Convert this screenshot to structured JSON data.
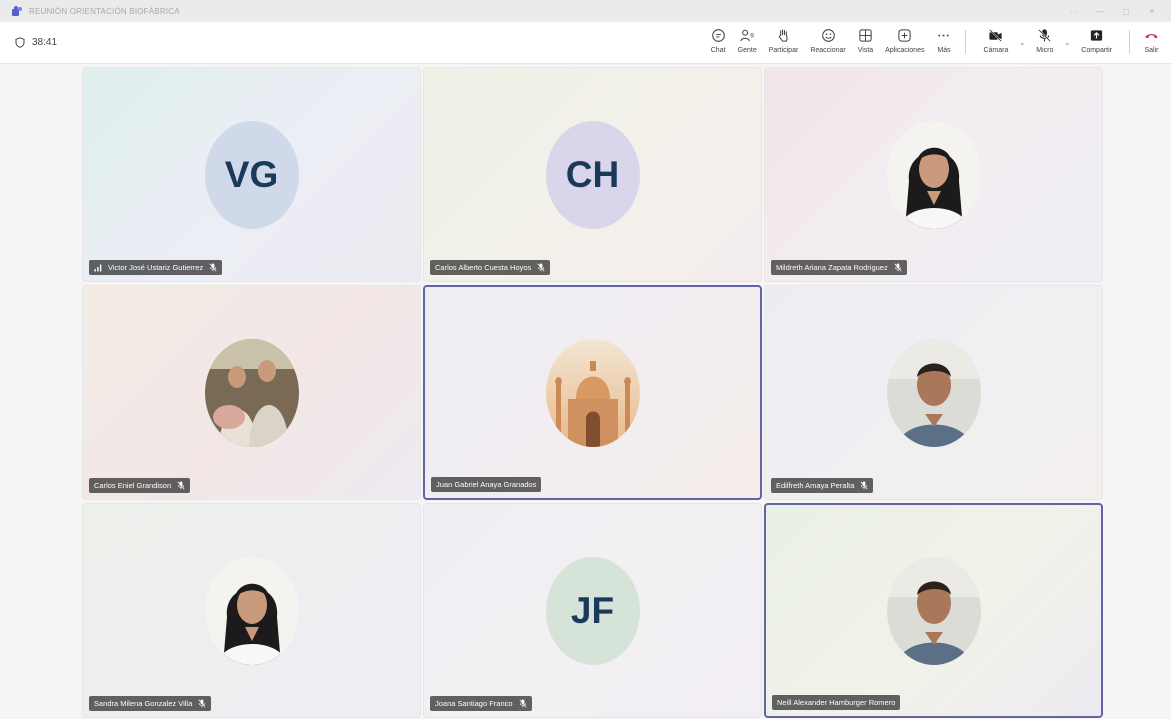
{
  "window": {
    "title": "REUNIÓN ORIENTACIÓN BIOFÁBRICA",
    "controls": [
      "···",
      "—",
      "▢",
      "✕"
    ]
  },
  "toolbar": {
    "timer": "38:41",
    "chat": "Chat",
    "people": "Gente",
    "people_count": "9",
    "raise": "Participar",
    "react": "Reaccionar",
    "view": "Vista",
    "apps": "Aplicaciones",
    "more": "Más",
    "camera": "Cámara",
    "mic": "Micro",
    "share": "Compartir",
    "leave": "Salir"
  },
  "colors": {
    "accent": "#6264a7",
    "leave": "#c4314b"
  },
  "participants": [
    {
      "name": "Victor José Ustariz Gutierrez",
      "initials": "VG",
      "avatar": "initials",
      "muted": true,
      "signal_icon": true
    },
    {
      "name": "Carlos Alberto Cuesta Hoyos",
      "initials": "CH",
      "avatar": "initials",
      "muted": true
    },
    {
      "name": "Mildreth Ariana Zapata Rodriguez",
      "avatar": "photo-woman",
      "muted": true
    },
    {
      "name": "Carlos Eniel Grandison",
      "avatar": "photo-group",
      "muted": true
    },
    {
      "name": "Juan Gabriel Anaya Granados",
      "avatar": "photo-taj-mahal",
      "muted": false,
      "active": true
    },
    {
      "name": "Edilfreth Amaya Peralta",
      "avatar": "photo-man",
      "muted": true
    },
    {
      "name": "Sandra Milena Gonzalez Villa",
      "avatar": "photo-woman",
      "muted": true
    },
    {
      "name": "Joana Santiago Franco",
      "initials": "JF",
      "avatar": "initials",
      "muted": true
    },
    {
      "name": "Neill Alexander Hamburger Romero",
      "avatar": "photo-man",
      "muted": false,
      "active": true
    }
  ]
}
